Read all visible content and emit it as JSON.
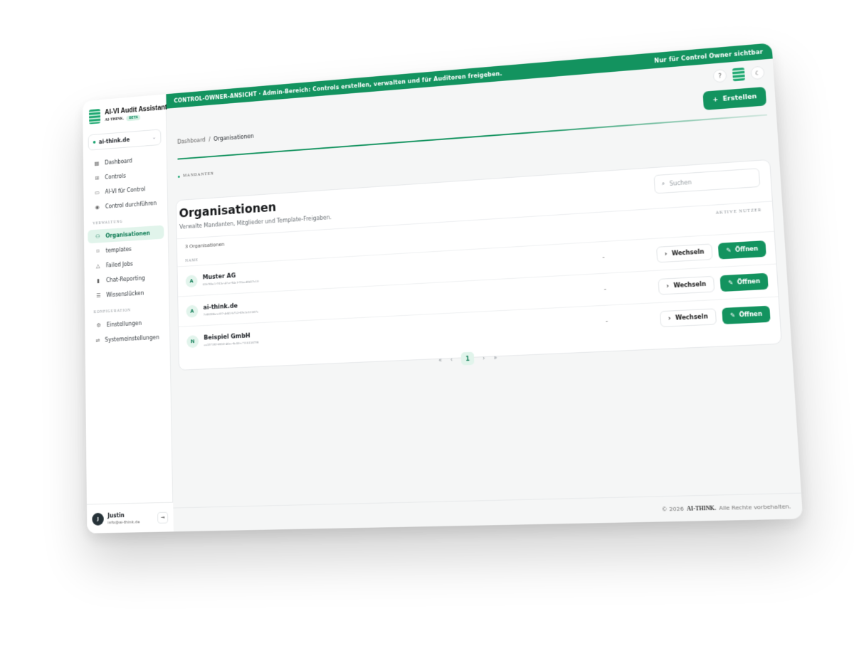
{
  "app": {
    "title": "AI-VI Audit Assistant",
    "company": "AI-THINK.",
    "badge": "BETA"
  },
  "org_switcher": {
    "current": "ai-think.de"
  },
  "sidebar": {
    "items_main": [
      {
        "label": "Dashboard",
        "icon": "grid-icon"
      },
      {
        "label": "Controls",
        "icon": "plus-square-icon"
      },
      {
        "label": "AI-VI für Control",
        "icon": "chat-icon"
      },
      {
        "label": "Control durchführen",
        "icon": "eye-icon"
      }
    ],
    "section_verwaltung": "VERWALTUNG",
    "items_verwaltung": [
      {
        "label": "Organisationen",
        "icon": "org-tree-icon",
        "active": true
      },
      {
        "label": "templates",
        "icon": "bookmark-icon"
      },
      {
        "label": "Failed Jobs",
        "icon": "warning-icon"
      },
      {
        "label": "Chat-Reporting",
        "icon": "bar-chart-icon"
      },
      {
        "label": "Wissenslücken",
        "icon": "list-search-icon"
      }
    ],
    "section_konfiguration": "KONFIGURATION",
    "items_konfiguration": [
      {
        "label": "Einstellungen",
        "icon": "gear-icon"
      },
      {
        "label": "Systemeinstellungen",
        "icon": "sliders-icon"
      }
    ]
  },
  "user": {
    "initial": "J",
    "name": "Justin",
    "email": "info@ai-think.de"
  },
  "banner": {
    "left": "CONTROL-OWNER-ANSICHT · Admin-Bereich: Controls erstellen, verwalten und für Auditoren freigeben.",
    "right": "Nur für Control Owner sichtbar"
  },
  "breadcrumb": {
    "root": "Dashboard",
    "separator": "/",
    "current": "Organisationen"
  },
  "create_button": "Erstellen",
  "section_label": "MANDANTEN",
  "page": {
    "title": "Organisationen",
    "subtitle": "Verwalte Mandanten, Mitglieder und Template-Freigaben.",
    "search_placeholder": "Suchen"
  },
  "table": {
    "count_label": "3 Organisationen",
    "col_name": "NAME",
    "col_users": "AKTIVE NUTZER",
    "rows": [
      {
        "initial": "A",
        "name": "Muster AG",
        "id": "61b76be5-913e-47ec-94e1-91aed8d27c10",
        "users": "-"
      },
      {
        "initial": "A",
        "name": "ai-think.de",
        "id": "7c66386a-ef07-4d45-b753-89c3c331f07e",
        "users": "-"
      },
      {
        "initial": "N",
        "name": "Beispiel GmbH",
        "id": "ea597182-d656-46ce-8e66-e7116158798",
        "users": "-"
      }
    ],
    "switch_label": "Wechseln",
    "open_label": "Öffnen"
  },
  "pagination": {
    "first": "«",
    "prev": "‹",
    "current": "1",
    "next": "›",
    "last": "»"
  },
  "footer": {
    "prefix": "© 2026",
    "brand": "AI-THINK.",
    "suffix": "Alle Rechte vorbehalten."
  },
  "colors": {
    "accent": "#13935f",
    "accent_light": "#e1f4eb"
  }
}
